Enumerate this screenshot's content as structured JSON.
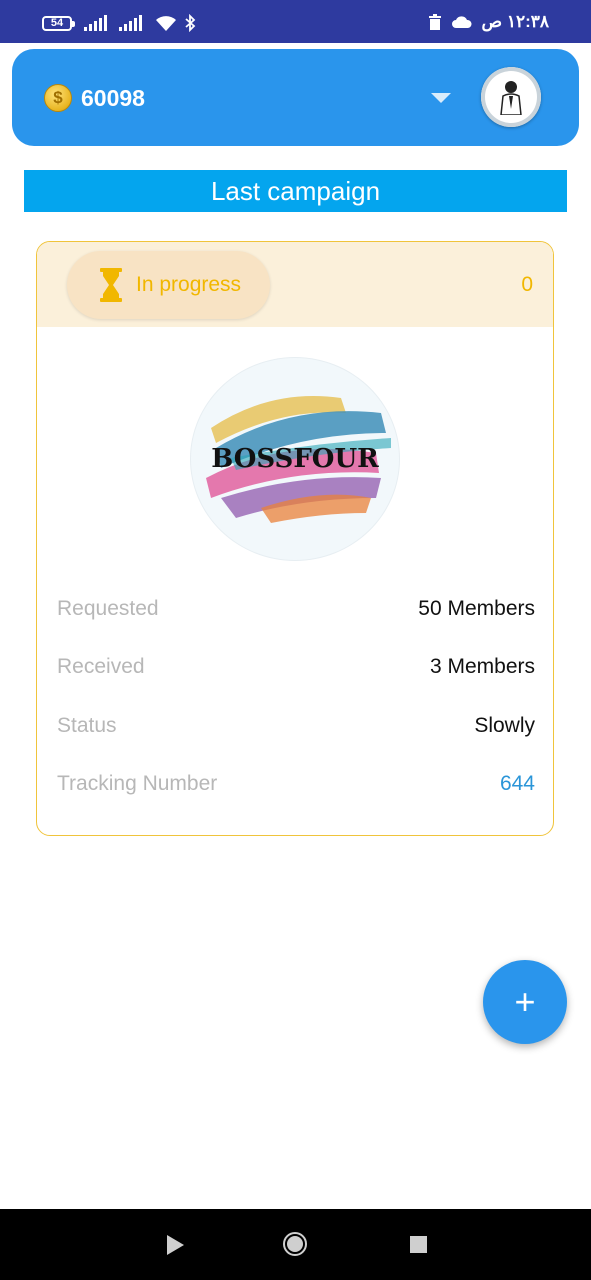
{
  "status_bar": {
    "battery": "54",
    "time": "١٢:٣٨ ص",
    "icons": [
      "battery-icon",
      "signal-icon",
      "signal-icon",
      "wifi-icon",
      "bluetooth-icon",
      "trash-icon",
      "cloud-icon"
    ]
  },
  "header": {
    "coin_icon": "coin-dollar-icon",
    "balance": "60098",
    "dropdown_icon": "caret-down-icon",
    "avatar_icon": "user-avatar"
  },
  "section": {
    "title": "Last campaign"
  },
  "campaign": {
    "status_label": "In progress",
    "status_icon": "hourglass-icon",
    "count": "0",
    "logo_text": "BOSSFOUR",
    "rows": [
      {
        "label": "Requested",
        "value": "50 Members"
      },
      {
        "label": "Received",
        "value": "3 Members"
      },
      {
        "label": "Status",
        "value": "Slowly"
      },
      {
        "label": "Tracking Number",
        "value": "644"
      }
    ]
  },
  "fab": {
    "label": "+"
  },
  "colors": {
    "primary": "#2a95ec",
    "section_bg": "#04a5ee",
    "accent_yellow": "#f1b700",
    "card_border": "#f0c43b",
    "status_bar": "#2e3a9f",
    "link": "#2a95d8"
  }
}
